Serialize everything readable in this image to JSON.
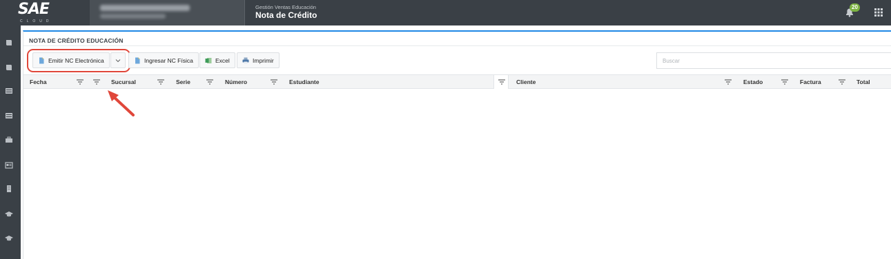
{
  "app": {
    "logo_text": "SAE",
    "logo_sub": "CLOUD",
    "module": "Gestión Ventas Educación",
    "page_title": "Nota de Crédito",
    "notifications_count": "20"
  },
  "panel": {
    "title": "NOTA DE CRÉDITO EDUCACIÓN"
  },
  "toolbar": {
    "emit_label": "Emitir NC Electrónica",
    "ingresar_label": "Ingresar NC Física",
    "excel_label": "Excel",
    "print_label": "Imprimir",
    "search_placeholder": "Buscar"
  },
  "grid": {
    "columns": [
      "Fecha",
      "Sucursal",
      "Serie",
      "Número",
      "Estudiante",
      "Cliente",
      "Estado",
      "Factura",
      "Total"
    ]
  },
  "colors": {
    "topbar": "#3a4046",
    "accent": "#1e88e5",
    "highlight": "#e0473a",
    "badge": "#7cb342"
  }
}
